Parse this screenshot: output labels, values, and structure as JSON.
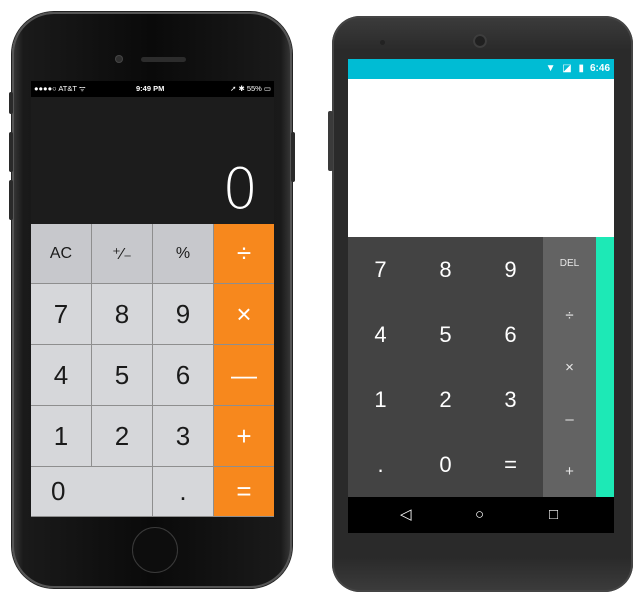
{
  "ios": {
    "status": {
      "carrier": "●●●●○ AT&T ᯤ",
      "time": "9:49 PM",
      "right": "➚ ✱ 55% ▭"
    },
    "display": "0",
    "keys": [
      {
        "label": "AC",
        "type": "top"
      },
      {
        "label": "⁺∕₋",
        "type": "top"
      },
      {
        "label": "%",
        "type": "top"
      },
      {
        "label": "÷",
        "type": "op"
      },
      {
        "label": "7",
        "type": "num"
      },
      {
        "label": "8",
        "type": "num"
      },
      {
        "label": "9",
        "type": "num"
      },
      {
        "label": "×",
        "type": "op"
      },
      {
        "label": "4",
        "type": "num"
      },
      {
        "label": "5",
        "type": "num"
      },
      {
        "label": "6",
        "type": "num"
      },
      {
        "label": "—",
        "type": "op"
      },
      {
        "label": "1",
        "type": "num"
      },
      {
        "label": "2",
        "type": "num"
      },
      {
        "label": "3",
        "type": "num"
      },
      {
        "label": "+",
        "type": "op"
      },
      {
        "label": "0",
        "type": "num zero"
      },
      {
        "label": ".",
        "type": "num"
      },
      {
        "label": "=",
        "type": "op"
      }
    ]
  },
  "android": {
    "status": {
      "icons": "▼ ◪ ▮",
      "time": "6:46"
    },
    "digits": [
      "7",
      "8",
      "9",
      "4",
      "5",
      "6",
      "1",
      "2",
      "3",
      ".",
      "0",
      "="
    ],
    "ops": [
      "DEL",
      "÷",
      "×",
      "–",
      "+"
    ],
    "nav": {
      "back": "◁",
      "home": "○",
      "recents": "□"
    },
    "colors": {
      "status_bar": "#00bcd4",
      "drawer": "#1de9b6",
      "pad": "#434343",
      "ops": "#636363"
    }
  }
}
